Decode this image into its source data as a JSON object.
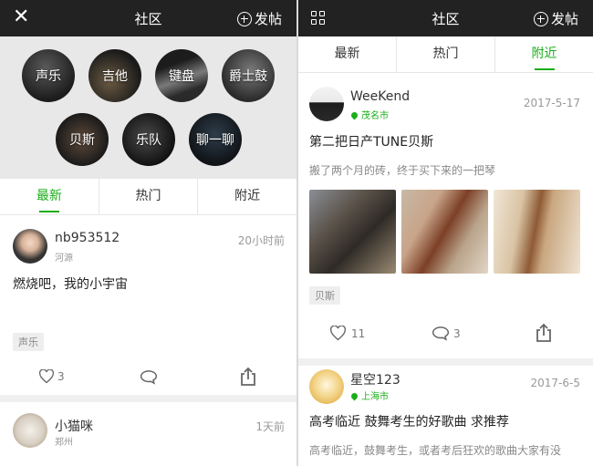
{
  "left": {
    "header": {
      "title": "社区",
      "post_label": "发帖"
    },
    "categories": [
      "声乐",
      "吉他",
      "键盘",
      "爵士鼓",
      "贝斯",
      "乐队",
      "聊一聊"
    ],
    "tabs": [
      "最新",
      "热门",
      "附近"
    ],
    "active_tab": "最新",
    "posts": [
      {
        "user": "nb953512",
        "location": "河源",
        "time": "20小时前",
        "title": "燃烧吧，我的小宇宙",
        "tag": "声乐",
        "like_count": "3"
      },
      {
        "user": "小猫咪",
        "location": "郑州",
        "time": "1天前"
      }
    ]
  },
  "right": {
    "header": {
      "title": "社区",
      "post_label": "发帖"
    },
    "tabs": [
      "最新",
      "热门",
      "附近"
    ],
    "active_tab": "附近",
    "posts": [
      {
        "user": "WeeKend",
        "location": "茂名市",
        "time": "2017-5-17",
        "title": "第二把日产TUNE贝斯",
        "body": "搬了两个月的砖，终于买下来的一把琴",
        "tag": "贝斯",
        "like_count": "11",
        "comment_count": "3"
      },
      {
        "user": "星空123",
        "location": "上海市",
        "time": "2017-6-5",
        "title": "高考临近 鼓舞考生的好歌曲 求推荐",
        "body": "高考临近，鼓舞考生，或者考后狂欢的歌曲大家有没"
      }
    ]
  },
  "colors": {
    "accent": "#1aad19",
    "topbar": "#222222",
    "category_band": "#e8e8e8"
  },
  "icons": [
    "close-icon",
    "grid-icon",
    "plus-circle-icon",
    "heart-icon",
    "comment-icon",
    "share-icon",
    "location-pin-icon"
  ]
}
